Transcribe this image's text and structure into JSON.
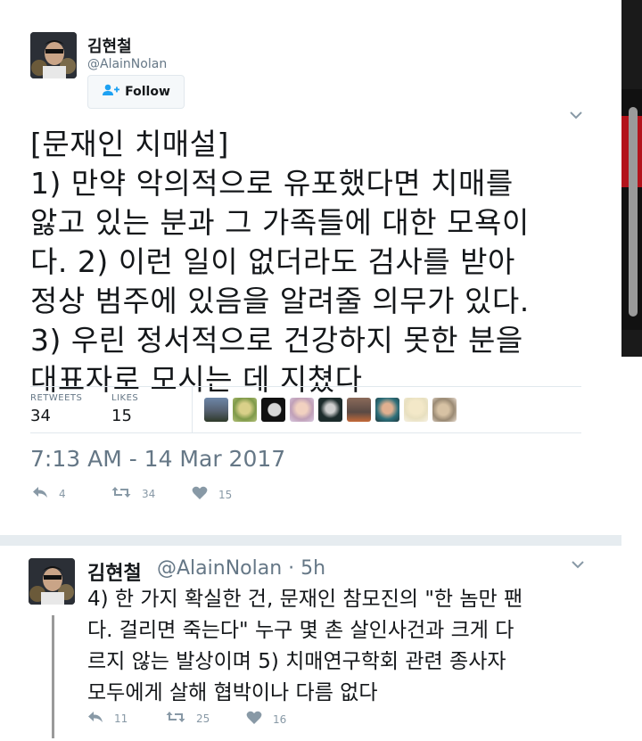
{
  "tweet": {
    "author_name": "김현철",
    "author_handle": "@AlainNolan",
    "follow_label": "Follow",
    "text_lines": [
      "[문재인 치매설]",
      "1) 만약 악의적으로 유포했다면 치매를",
      "앓고 있는 분과 그 가족들에 대한 모욕이",
      "다. 2) 이런 일이 없더라도 검사를 받아",
      "정상 범주에 있음을 알려줄 의무가 있다.",
      "3) 우린 정서적으로 건강하지 못한 분을",
      "대표자로 모시는 데 지쳤다"
    ],
    "stats": {
      "retweets_label": "RETWEETS",
      "retweets_value": "34",
      "likes_label": "LIKES",
      "likes_value": "15"
    },
    "timestamp": "7:13 AM - 14 Mar 2017",
    "actions": {
      "reply_count": "4",
      "retweet_count": "34",
      "like_count": "15"
    }
  },
  "reply": {
    "author_name": "김현철",
    "meta": "@AlainNolan · 5h",
    "text_lines": [
      "4) 한 가지 확실한 건, 문재인 참모진의 \"한 놈만 팬",
      "다. 걸리면 죽는다\" 누구 몇 촌 살인사건과 크게 다",
      "르지 않는 발상이며 5) 치매연구학회 관련 종사자",
      "모두에게 살해 협박이나 다름 없다"
    ],
    "actions": {
      "reply_count": "11",
      "retweet_count": "25",
      "like_count": "16"
    }
  },
  "colors": {
    "text": "#14171a",
    "secondary": "#657786",
    "icon": "#8899a6",
    "border": "#e1e8ed"
  },
  "icons": [
    "follow-person-icon",
    "chevron-down-icon",
    "reply-icon",
    "retweet-icon",
    "heart-icon"
  ]
}
